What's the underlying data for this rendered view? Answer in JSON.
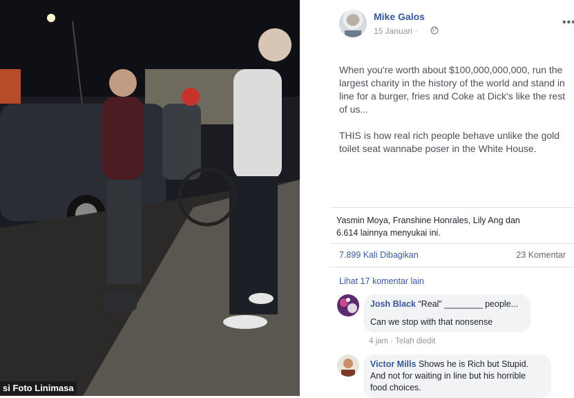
{
  "photo": {
    "caption": "si Foto Linimasa"
  },
  "post": {
    "author": "Mike Galos",
    "date": "15 Januari",
    "date_separator": "·",
    "text_paragraphs": [
      "When you're worth about $100,000,000,000, run the largest charity in the history of the world and stand in line for a burger, fries and Coke at Dick's like the rest of us...",
      "THIS is how real rich people behave unlike the gold toilet seat wannabe poser in the White House."
    ],
    "likes": "Yasmin Moya, Franshine Honrales, Lily Ang dan 6.614 lainnya menyukai ini.",
    "shares": "7.899 Kali Dibagikan",
    "comments_count": "23 Komentar",
    "view_more": "Lihat 17 komentar lain"
  },
  "comments": [
    {
      "name": "Josh Black",
      "line1": "“Real” ________ people...",
      "line2": "Can we stop with that nonsense",
      "meta": "4 jam · Telah diedit"
    },
    {
      "name": "Victor Mills",
      "line1": "Shows he is Rich but Stupid.",
      "line2": "And not for waiting in line but his horrible",
      "line3": "food choices."
    }
  ],
  "icons": {
    "expand": "expand-icon",
    "next": "chevron-right-icon",
    "globe": "globe-icon",
    "more": "more-options-icon"
  },
  "colors": {
    "link": "#365899",
    "meta": "#90949c",
    "bubble": "#f2f3f5"
  }
}
